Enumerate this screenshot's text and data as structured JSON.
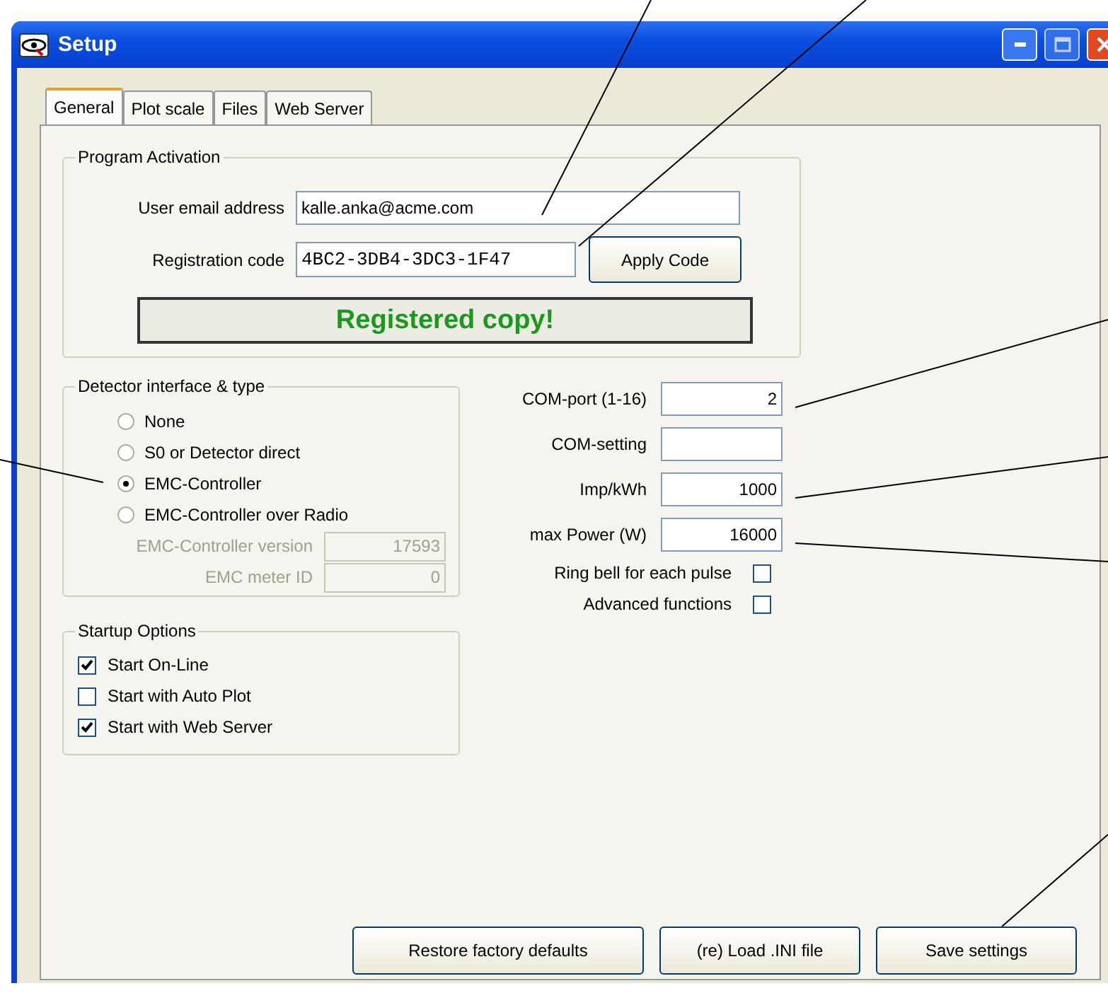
{
  "window": {
    "title": "Setup"
  },
  "tabs": [
    {
      "label": "General",
      "selected": true
    },
    {
      "label": "Plot scale",
      "selected": false
    },
    {
      "label": "Files",
      "selected": false
    },
    {
      "label": "Web Server",
      "selected": false
    }
  ],
  "program_activation": {
    "title": "Program Activation",
    "fields": [
      {
        "label": "User email address",
        "value": "kalle.anka@acme.com",
        "kind": "text"
      },
      {
        "label": "Registration code",
        "value": "4BC2-3DB4-3DC3-1F47",
        "kind": "code"
      }
    ],
    "apply_button": "Apply Code",
    "status": "Registered copy!"
  },
  "detector": {
    "title": "Detector interface & type",
    "options": [
      {
        "label": "None",
        "selected": false
      },
      {
        "label": "S0 or Detector direct",
        "selected": false
      },
      {
        "label": "EMC-Controller",
        "selected": true
      },
      {
        "label": "EMC-Controller over Radio",
        "selected": false
      }
    ],
    "fields": [
      {
        "label": "EMC-Controller version",
        "value": "17593",
        "disabled": true
      },
      {
        "label": "EMC meter ID",
        "value": "0",
        "disabled": true
      }
    ]
  },
  "startup": {
    "title": "Startup Options",
    "options": [
      {
        "label": "Start On-Line",
        "checked": true
      },
      {
        "label": "Start with Auto Plot",
        "checked": false
      },
      {
        "label": "Start with Web Server",
        "checked": true
      }
    ]
  },
  "settings": {
    "fields": [
      {
        "label": "COM-port (1-16)",
        "value": "2"
      },
      {
        "label": "COM-setting"
      },
      {
        "label": "Imp/kWh",
        "value": "1000"
      },
      {
        "label": "max Power (W)",
        "value": "16000"
      }
    ],
    "checks": [
      {
        "label": "Ring bell for each pulse",
        "checked": false
      },
      {
        "label": "Advanced functions",
        "checked": false
      }
    ]
  },
  "buttons": [
    "Restore factory defaults",
    "(re) Load .INI file",
    "Save settings"
  ]
}
